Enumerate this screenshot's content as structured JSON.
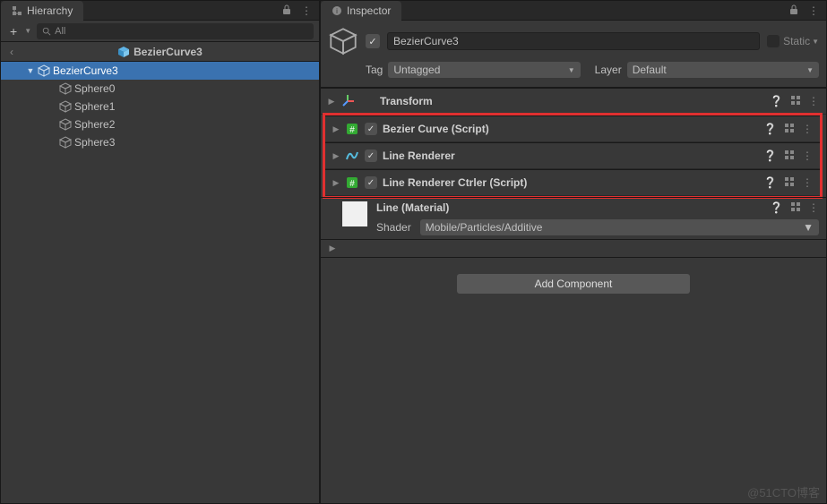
{
  "hierarchy": {
    "tab_label": "Hierarchy",
    "search_placeholder": "All",
    "breadcrumb": "BezierCurve3",
    "items": [
      {
        "name": "BezierCurve3",
        "depth": 0,
        "selected": true,
        "expanded": true
      },
      {
        "name": "Sphere0",
        "depth": 1,
        "selected": false
      },
      {
        "name": "Sphere1",
        "depth": 1,
        "selected": false
      },
      {
        "name": "Sphere2",
        "depth": 1,
        "selected": false
      },
      {
        "name": "Sphere3",
        "depth": 1,
        "selected": false
      }
    ]
  },
  "inspector": {
    "tab_label": "Inspector",
    "object_name": "BezierCurve3",
    "enabled": true,
    "static_label": "Static",
    "tag_label": "Tag",
    "tag_value": "Untagged",
    "layer_label": "Layer",
    "layer_value": "Default",
    "components": [
      {
        "title": "Transform",
        "has_checkbox": false,
        "icon": "transform",
        "highlighted": false
      },
      {
        "title": "Bezier Curve (Script)",
        "has_checkbox": true,
        "icon": "script",
        "highlighted": true
      },
      {
        "title": "Line Renderer",
        "has_checkbox": true,
        "icon": "linerenderer",
        "highlighted": true
      },
      {
        "title": "Line Renderer Ctrler (Script)",
        "has_checkbox": true,
        "icon": "script",
        "highlighted": true
      }
    ],
    "material": {
      "name": "Line (Material)",
      "shader_label": "Shader",
      "shader_value": "Mobile/Particles/Additive"
    },
    "add_component_label": "Add Component"
  },
  "watermark": "@51CTO博客"
}
